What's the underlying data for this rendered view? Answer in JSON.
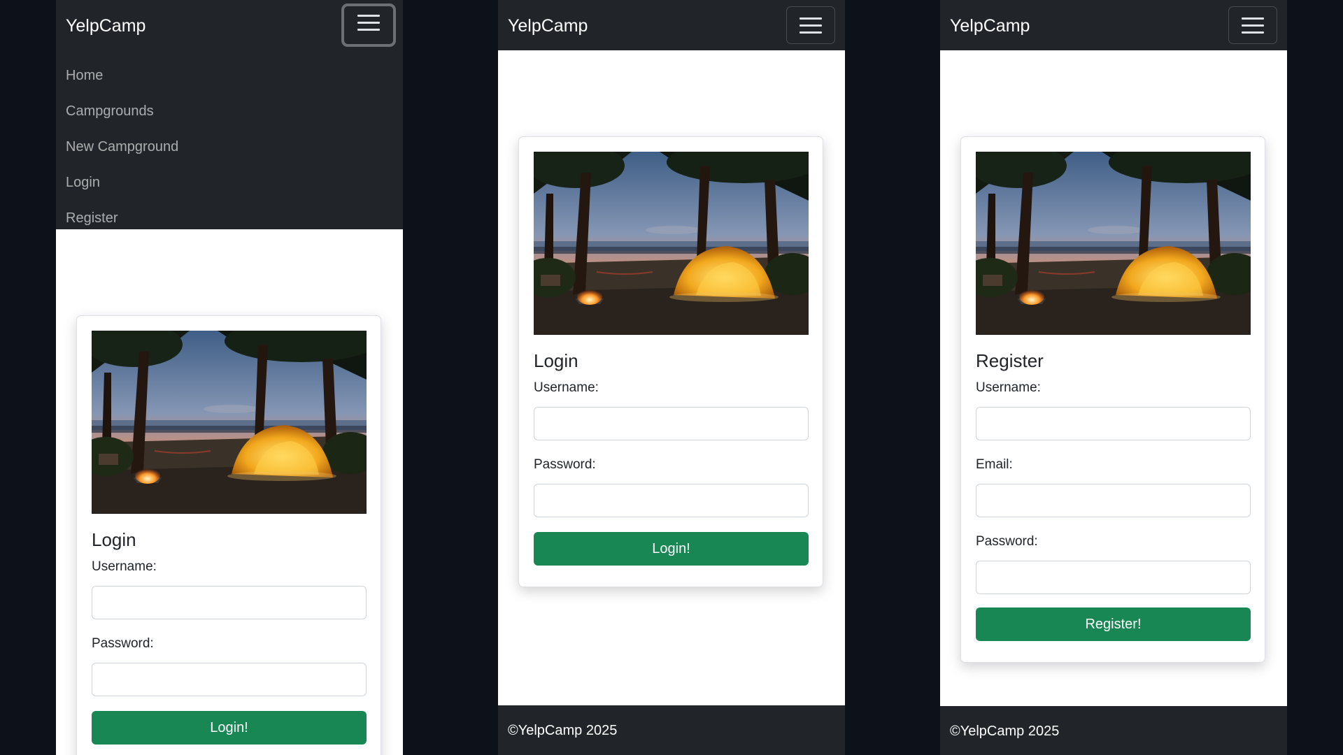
{
  "app": {
    "brand": "YelpCamp"
  },
  "icons": {
    "toggler": "hamburger-menu-icon"
  },
  "colors": {
    "navbar": "#212529",
    "button": "#198754",
    "backdrop": "#0d111a"
  },
  "nav_menu": {
    "items": [
      {
        "label": "Home"
      },
      {
        "label": "Campgrounds"
      },
      {
        "label": "New Campground"
      },
      {
        "label": "Login"
      },
      {
        "label": "Register"
      }
    ]
  },
  "login": {
    "title": "Login",
    "username_label": "Username:",
    "password_label": "Password:",
    "username_value": "",
    "password_value": "",
    "submit_label": "Login!"
  },
  "register": {
    "title": "Register",
    "username_label": "Username:",
    "email_label": "Email:",
    "password_label": "Password:",
    "username_value": "",
    "email_value": "",
    "password_value": "",
    "submit_label": "Register!"
  },
  "footer": {
    "text": "©YelpCamp 2025"
  }
}
